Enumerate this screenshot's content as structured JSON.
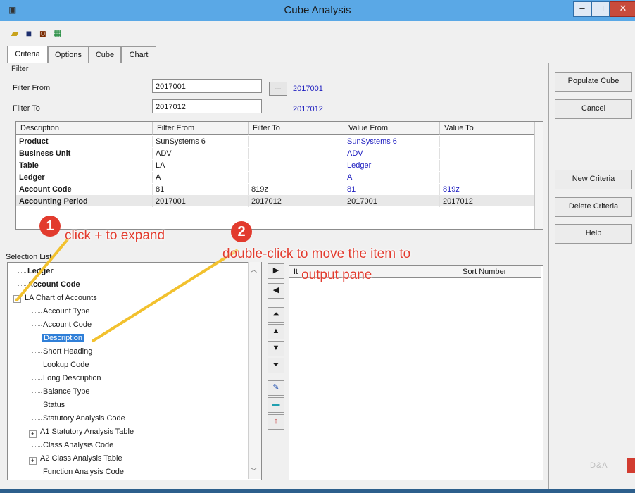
{
  "window": {
    "title": "Cube Analysis",
    "controls": [
      "–",
      "□",
      "✕"
    ]
  },
  "toolbar": {
    "icons": [
      "open-folder-icon",
      "save-icon",
      "binoculars-icon",
      "excel-icon"
    ]
  },
  "tabs": [
    {
      "label": "Criteria",
      "active": true
    },
    {
      "label": "Options",
      "active": false
    },
    {
      "label": "Cube",
      "active": false
    },
    {
      "label": "Chart",
      "active": false
    }
  ],
  "filter": {
    "group_label": "Filter",
    "from_label": "Filter From",
    "from_value": "2017001",
    "from_resolved": "2017001",
    "to_label": "Filter To",
    "to_value": "2017012",
    "to_resolved": "2017012",
    "browse_label": "..."
  },
  "grid": {
    "headers": [
      "Description",
      "Filter From",
      "Filter To",
      "Value From",
      "Value To"
    ],
    "rows": [
      [
        "Product",
        "SunSystems 6",
        "",
        "SunSystems 6",
        ""
      ],
      [
        "Business Unit",
        "ADV",
        "",
        "ADV",
        ""
      ],
      [
        "Table",
        "LA",
        "",
        "Ledger",
        ""
      ],
      [
        "Ledger",
        "A",
        "",
        "A",
        ""
      ],
      [
        "Account Code",
        "81",
        "819z",
        "81",
        "819z"
      ],
      [
        "Accounting Period",
        "2017001",
        "2017012",
        "2017001",
        "2017012"
      ]
    ]
  },
  "buttons": {
    "populate": "Populate Cube",
    "cancel": "Cancel",
    "new_criteria": "New Criteria",
    "delete_criteria": "Delete Criteria",
    "help": "Help"
  },
  "selection_list": {
    "label": "Selection List",
    "items": [
      {
        "label": "Ledger",
        "bold": true
      },
      {
        "label": "Account Code",
        "bold": true
      },
      {
        "label": "LA  Chart of Accounts",
        "expander": "−"
      },
      {
        "label": "Account Type"
      },
      {
        "label": "Account Code"
      },
      {
        "label": "Description",
        "selected": true
      },
      {
        "label": "Short Heading"
      },
      {
        "label": "Lookup Code"
      },
      {
        "label": "Long Description"
      },
      {
        "label": "Balance Type"
      },
      {
        "label": "Status"
      },
      {
        "label": "Statutory Analysis Code"
      },
      {
        "label": "A1  Statutory Analysis Table",
        "expander": "+"
      },
      {
        "label": "Class  Analysis Code"
      },
      {
        "label": "A2  Class Analysis Table",
        "expander": "+"
      },
      {
        "label": "Function  Analysis Code"
      }
    ]
  },
  "move_buttons": [
    "move-right-icon",
    "move-left-icon",
    "move-top-icon",
    "move-up-icon",
    "move-down-icon",
    "move-bottom-icon",
    "edit-icon",
    "clear-icon",
    "sort-icon"
  ],
  "output": {
    "headers": [
      "It",
      "Sort Number"
    ]
  },
  "annotations": {
    "step1_number": "1",
    "step1_text": "click + to expand",
    "step2_number": "2",
    "step2_text_line1": "double-click to move the item to",
    "step2_text_line2": "output pane"
  },
  "brand": {
    "logo_text": "D&A",
    "accent": "#e23b2e",
    "titlebar_color": "#5aa8e6"
  }
}
